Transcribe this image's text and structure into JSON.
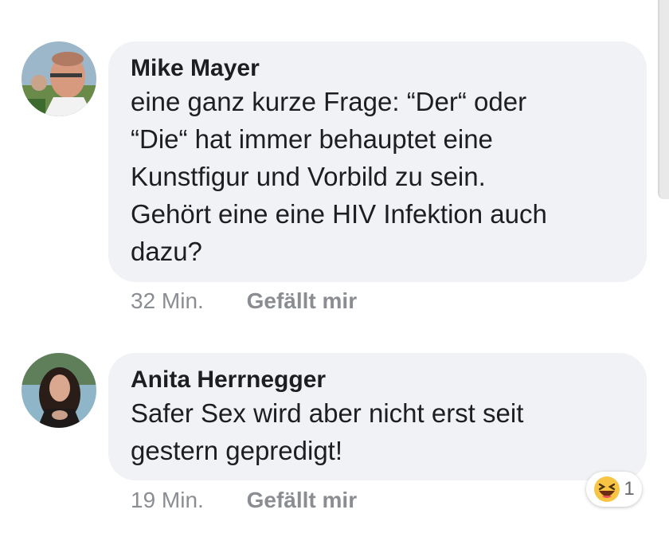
{
  "comments": [
    {
      "author": "Mike Mayer",
      "text_lines": [
        "eine ganz kurze Frage: “Der“ oder",
        "“Die“ hat immer behauptet eine",
        "Kunstfigur und Vorbild zu sein.",
        "Gehört eine eine HIV Infektion auch",
        "dazu?"
      ],
      "time": "32 Min.",
      "like_label": "Gefällt mir"
    },
    {
      "author": "Anita Herrnegger",
      "text_lines": [
        "Safer Sex wird aber nicht erst seit",
        "gestern gepredigt!"
      ],
      "time": "19 Min.",
      "like_label": "Gefällt mir",
      "reaction": {
        "icon": "laughing-emoji-icon",
        "count": "1"
      }
    }
  ]
}
